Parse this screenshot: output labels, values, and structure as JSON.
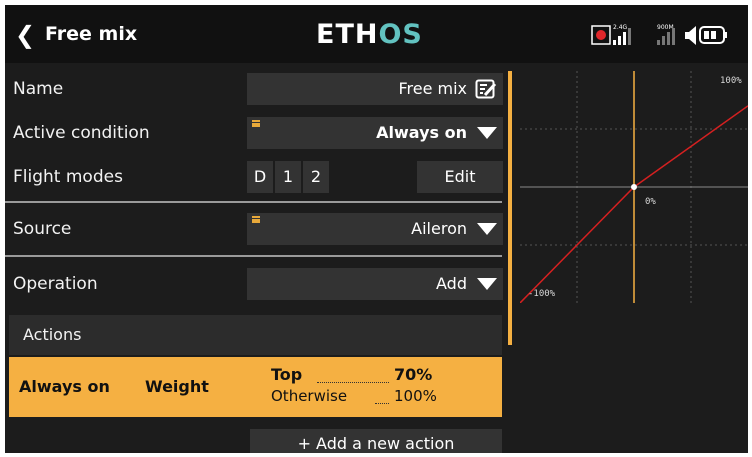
{
  "header": {
    "back_glyph": "❮",
    "title": "Free mix",
    "logo_main": "ETH",
    "logo_accent": "OS",
    "logo_accent_color": "#62c2c0",
    "status": {
      "record_color": "#e0262a",
      "rf_label_1": "2.4G",
      "rf_label_2": "900M"
    }
  },
  "rows": {
    "name": {
      "label": "Name",
      "value": "Free mix"
    },
    "active_condition": {
      "label": "Active condition",
      "value": "Always on"
    },
    "flight_modes": {
      "label": "Flight modes",
      "modes": [
        "D",
        "1",
        "2"
      ],
      "edit_label": "Edit"
    },
    "source": {
      "label": "Source",
      "value": "Aileron"
    },
    "operation": {
      "label": "Operation",
      "value": "Add"
    }
  },
  "actions": {
    "header": "Actions",
    "items": [
      {
        "condition": "Always on",
        "type": "Weight",
        "top_label": "Top",
        "top_value": "70%",
        "otherwise_label": "Otherwise",
        "otherwise_value": "100%"
      }
    ],
    "add_label": "+ Add a new action"
  },
  "graph": {
    "label_top": "100%",
    "label_center": "0%",
    "label_bottom": "-100%",
    "line_color": "#d42020",
    "cursor_color": "#f5b042",
    "chart_data": {
      "type": "line",
      "x": [
        -100,
        0,
        100
      ],
      "y": [
        -100,
        0,
        70
      ],
      "xlim": [
        -100,
        100
      ],
      "ylim": [
        -100,
        100
      ],
      "grid": true
    }
  },
  "colors": {
    "accent": "#f5b042",
    "background": "#1c1c1c",
    "field": "#333333"
  }
}
